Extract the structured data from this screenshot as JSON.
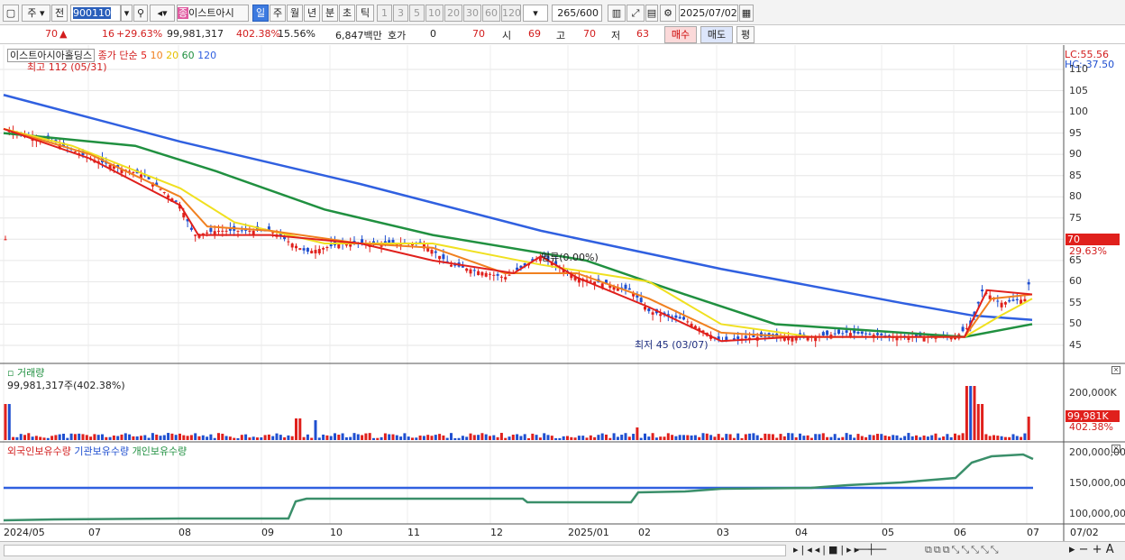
{
  "toolbar": {
    "market": "주",
    "prev": "전",
    "code": "900110",
    "badge": "종",
    "name": "이스트아시",
    "periods": [
      "일",
      "주",
      "월",
      "년",
      "분",
      "초",
      "틱"
    ],
    "nums": [
      "1",
      "3",
      "5",
      "10",
      "20",
      "30",
      "60",
      "120"
    ],
    "count": "265",
    "count_total": "/600",
    "date": "2025/07/02"
  },
  "info": {
    "price": "70",
    "change": "16",
    "pct": "+29.63%",
    "volume": "99,981,317",
    "vol_pct": "402.38%",
    "turnover": "15.56%",
    "amount": "6,847백만",
    "hoga_label": "호가",
    "hoga_val": "0",
    "cur": "70",
    "open_label": "시",
    "open": "69",
    "high_label": "고",
    "high": "70",
    "low_label": "저",
    "low": "63",
    "buy": "매수",
    "sell": "매도",
    "eval": "평"
  },
  "price_panel": {
    "title": "이스트아시아홀딩스",
    "ma_label": "종가 단순",
    "ma_periods": [
      "5",
      "10",
      "20",
      "60",
      "120"
    ],
    "ma_colors": [
      "#e0201c",
      "#f08020",
      "#f0e020",
      "#209040",
      "#3060e0"
    ],
    "max_label": "최고 112 (05/31)",
    "min_label": "최저 45 (03/07)",
    "mid_label": "명류(0.00%)",
    "lc": "LC:55.56",
    "hc": "HC:-37.50",
    "ticks": [
      "110",
      "105",
      "100",
      "95",
      "90",
      "85",
      "80",
      "75",
      "70",
      "65",
      "60",
      "55",
      "50",
      "45"
    ],
    "last_price": "70",
    "last_pct": "29.63%"
  },
  "volume_panel": {
    "title": "거래량",
    "value": "99,981,317주(402.38%)",
    "tick": "200,000K",
    "last": "99,981K",
    "last_pct": "402.38%"
  },
  "holding_panel": {
    "legend": [
      "외국인보유수량",
      "기관보유수량",
      "개인보유수량"
    ],
    "ticks": [
      "200,000,00",
      "150,000,00",
      "100,000,00"
    ]
  },
  "x_axis": [
    "2024/05",
    "07",
    "08",
    "09",
    "10",
    "11",
    "12",
    "2025/01",
    "02",
    "03",
    "04",
    "05",
    "06",
    "07",
    "07/02"
  ]
}
